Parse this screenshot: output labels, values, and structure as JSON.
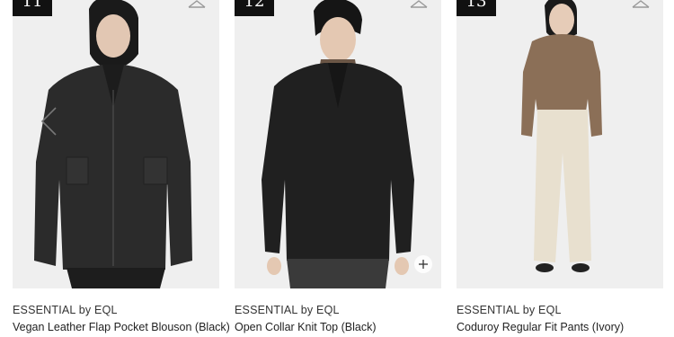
{
  "products": [
    {
      "rank": "11",
      "brand": "ESSENTIAL by EQL",
      "name": "Vegan Leather Flap Pocket Blouson (Black)",
      "image_desc": "model in black leather blouson",
      "icon": "heart-outline-icon"
    },
    {
      "rank": "12",
      "brand": "ESSENTIAL by EQL",
      "name": "Open Collar Knit Top (Black)",
      "image_desc": "model in black open collar knit",
      "icon": "heart-outline-icon"
    },
    {
      "rank": "13",
      "brand": "ESSENTIAL by EQL",
      "name": "Coduroy Regular Fit Pants (Ivory)",
      "image_desc": "model in ivory corduroy pants",
      "icon": "heart-outline-icon"
    }
  ],
  "colors": {
    "rank_bg": "#111111",
    "photo_bg": "#efefef"
  }
}
